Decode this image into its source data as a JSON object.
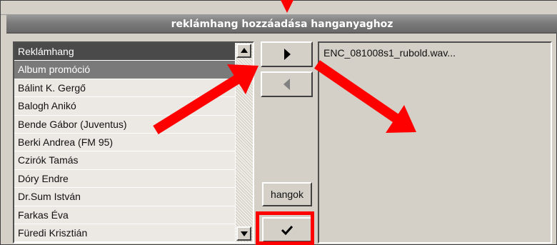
{
  "dialog": {
    "title": "reklámhang hozzáadása hanganyaghoz"
  },
  "list": {
    "header": "Reklámhang",
    "items": [
      "Album promóció",
      "Bálint K. Gergő",
      "Balogh Anikó",
      "Bende Gábor (Juventus)",
      "Berki Andrea (FM 95)",
      "Czirók Tamás",
      "Dóry Endre",
      "Dr.Sum István",
      "Farkas Éva",
      "Füredi Krisztián"
    ],
    "selected_index": 0
  },
  "buttons": {
    "add_icon": "triangle-right-icon",
    "remove_icon": "triangle-left-icon",
    "hangok_label": "hangok",
    "confirm_icon": "checkmark-icon"
  },
  "selected_files": {
    "items": [
      "ENC_081008s1_rubold.wav..."
    ]
  },
  "annotations": {
    "arrow_color": "#ff0000",
    "highlight_color": "#ff0000"
  }
}
